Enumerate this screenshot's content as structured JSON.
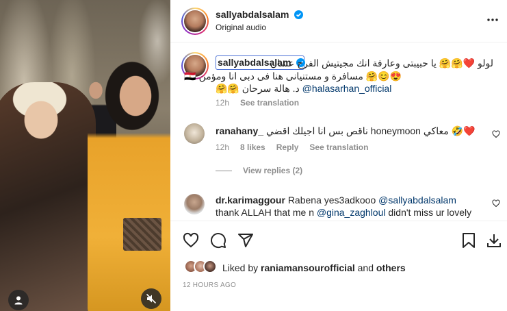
{
  "header": {
    "username": "sallyabdalsalam",
    "subtitle": "Original audio",
    "more_icon": "more-horizontal-icon"
  },
  "caption": {
    "username": "sallyabdalsalam",
    "line1": "لولو ❤️🤗🤗 يا حبيبتى وعارفة انك مجيتيش الفرح عشان",
    "line2": "😍😊🤗 مسافرة و مستنيانى هنا فى دبى انا ومؤمن 🇪🇬",
    "line3_rtl": "د. هالة سرحان 🤗🤗",
    "mention": "@halasarhan_official",
    "time": "12h",
    "see_translation": "See translation"
  },
  "comments": [
    {
      "username": "ranahany_",
      "text": "❤️🤣 معاكي honeymoon ناقص بس انا اجيلك اقضي",
      "time": "12h",
      "likes": "8 likes",
      "reply": "Reply",
      "see_translation": "See translation",
      "view_replies": "View replies (2)"
    },
    {
      "username": "dr.karimaggour",
      "text_start": "Rabena yes3adkooo",
      "mention1": "@sallyabdalsalam",
      "line2_start": "thank ALLAH that me n",
      "mention2": "@gina_zaghloul",
      "line2_end": "didn't miss ur lovely"
    }
  ],
  "actions": {
    "like_icon": "heart-icon",
    "comment_icon": "comment-icon",
    "share_icon": "send-icon",
    "save_icon": "bookmark-icon",
    "download_icon": "download-icon"
  },
  "likes": {
    "prefix": "Liked by",
    "user": "raniamansourofficial",
    "and": "and",
    "others": "others"
  },
  "timestamp": "12 HOURS AGO",
  "colors": {
    "verified": "#0095f6",
    "text": "#262626",
    "muted": "#8e8e8e",
    "link": "#00376b",
    "heart_red": "#ed4956"
  }
}
